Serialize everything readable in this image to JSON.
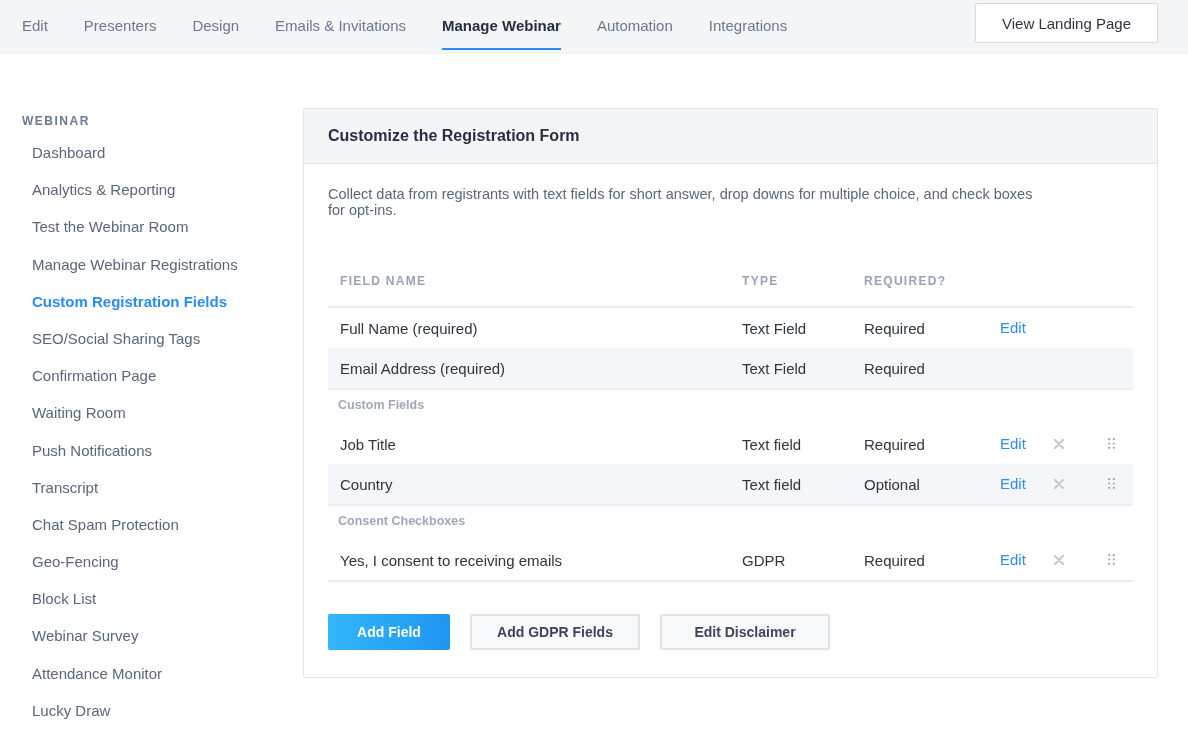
{
  "tabs": [
    {
      "label": "Edit",
      "selected": false
    },
    {
      "label": "Presenters",
      "selected": false
    },
    {
      "label": "Design",
      "selected": false
    },
    {
      "label": "Emails & Invitations",
      "selected": false
    },
    {
      "label": "Manage Webinar",
      "selected": true
    },
    {
      "label": "Automation",
      "selected": false
    },
    {
      "label": "Integrations",
      "selected": false
    }
  ],
  "view_button": "View Landing Page",
  "sidebar": {
    "heading": "WEBINAR",
    "items": [
      {
        "label": "Dashboard",
        "selected": false
      },
      {
        "label": "Analytics & Reporting",
        "selected": false
      },
      {
        "label": "Test the Webinar Room",
        "selected": false
      },
      {
        "label": "Manage Webinar Registrations",
        "selected": false
      },
      {
        "label": "Custom Registration Fields",
        "selected": true
      },
      {
        "label": "SEO/Social Sharing Tags",
        "selected": false
      },
      {
        "label": "Confirmation Page",
        "selected": false
      },
      {
        "label": "Waiting Room",
        "selected": false
      },
      {
        "label": "Push Notifications",
        "selected": false
      },
      {
        "label": "Transcript",
        "selected": false
      },
      {
        "label": "Chat Spam Protection",
        "selected": false
      },
      {
        "label": "Geo-Fencing",
        "selected": false
      },
      {
        "label": "Block List",
        "selected": false
      },
      {
        "label": "Webinar Survey",
        "selected": false
      },
      {
        "label": "Attendance Monitor",
        "selected": false
      },
      {
        "label": "Lucky Draw",
        "selected": false
      }
    ]
  },
  "card": {
    "title": "Customize the Registration Form",
    "description": "Collect data from registrants with text fields for short answer, drop downs for multiple choice, and check boxes for opt-ins.",
    "table": {
      "columns": [
        "FIELD NAME",
        "TYPE",
        "REQUIRED?"
      ],
      "rows": [
        {
          "kind": "field",
          "name": "Full Name (required)",
          "type": "Text Field",
          "required": "Required",
          "edit": "Edit",
          "removable": false,
          "draggable": false
        },
        {
          "kind": "field",
          "name": "Email Address (required)",
          "type": "Text Field",
          "required": "Required",
          "removable": false,
          "draggable": false
        },
        {
          "kind": "section",
          "label": "Custom Fields"
        },
        {
          "kind": "field",
          "name": "Job Title",
          "type": "Text field",
          "required": "Required",
          "edit": "Edit",
          "removable": true,
          "draggable": true
        },
        {
          "kind": "field",
          "name": "Country",
          "type": "Text field",
          "required": "Optional",
          "edit": "Edit",
          "removable": true,
          "draggable": true
        },
        {
          "kind": "section",
          "label": "Consent Checkboxes"
        },
        {
          "kind": "field",
          "name": "Yes, I consent to receiving emails",
          "type": "GDPR",
          "required": "Required",
          "edit": "Edit",
          "removable": true,
          "draggable": true
        }
      ]
    },
    "buttons": [
      {
        "label": "Add Field",
        "kind": "primary"
      },
      {
        "label": "Add GDPR Fields",
        "kind": "secondary"
      },
      {
        "label": "Edit Disclaimer",
        "kind": "secondary"
      }
    ]
  }
}
